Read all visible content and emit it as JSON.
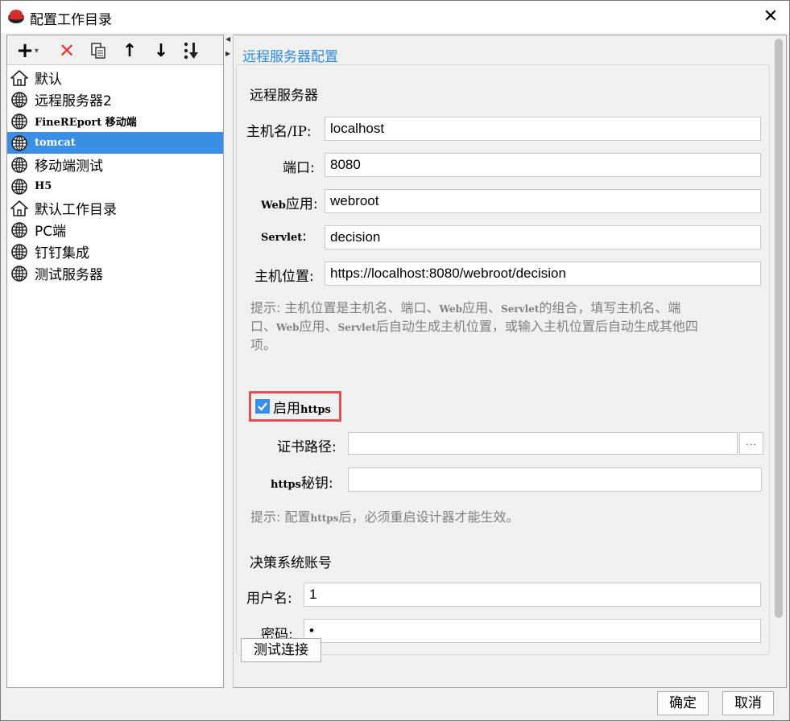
{
  "window": {
    "title": "配置工作目录",
    "close_glyph": "✕"
  },
  "toolbar": {
    "add": "+",
    "add_dropdown": "▾",
    "delete": "✕",
    "copy": "copy-icon",
    "move_up": "↑",
    "move_down": "↓",
    "sort": "sort-icon"
  },
  "tree": {
    "items": [
      {
        "label": "默认",
        "icon": "home-icon",
        "mono": false,
        "selected": false
      },
      {
        "label": "远程服务器2",
        "icon": "globe-icon",
        "mono": false,
        "selected": false
      },
      {
        "label": "FineREport 移动端",
        "icon": "globe-icon",
        "mono": true,
        "selected": false
      },
      {
        "label": "tomcat",
        "icon": "globe-icon",
        "mono": true,
        "selected": true
      },
      {
        "label": "移动端测试",
        "icon": "globe-icon",
        "mono": false,
        "selected": false
      },
      {
        "label": "H5",
        "icon": "globe-icon",
        "mono": true,
        "selected": false
      },
      {
        "label": "默认工作目录",
        "icon": "home-icon",
        "mono": false,
        "selected": false
      },
      {
        "label": "PC端",
        "icon": "globe-icon",
        "mono": false,
        "selected": false
      },
      {
        "label": "钉钉集成",
        "icon": "globe-icon",
        "mono": false,
        "selected": false
      },
      {
        "label": "测试服务器",
        "icon": "globe-icon",
        "mono": false,
        "selected": false
      }
    ]
  },
  "form": {
    "panel_title": "远程服务器配置",
    "remote_section": "远程服务器",
    "host_label": "主机名/IP",
    "host_label_suffix": ":",
    "host_value": "localhost",
    "port_label": "端口:",
    "port_value": "8080",
    "webapp_label_prefix": "Web",
    "webapp_label_suffix": "应用:",
    "webapp_value": "webroot",
    "servlet_label": "Servlet",
    "servlet_label_suffix": ":",
    "servlet_value": "decision",
    "location_label": "主机位置:",
    "location_value": "https://localhost:8080/webroot/decision",
    "hint1_line1_a": "提示: 主机位置是主机名、端口、",
    "hint1_line1_web": "Web",
    "hint1_line1_b": "应用、",
    "hint1_line1_servlet": "Servlet",
    "hint1_line1_c": "的组合，填写主机名、端",
    "hint1_line2_a": "口、",
    "hint1_line2_web": "Web",
    "hint1_line2_b": "应用、",
    "hint1_line2_servlet": "Servlet",
    "hint1_line2_c": "后自动生成主机位置，或输入主机位置后自动生成其他四",
    "hint1_line3": "项。",
    "https_checkbox_prefix": "启用",
    "https_checkbox_suffix": "https",
    "https_checked": true,
    "cert_label": "证书路径:",
    "cert_value": "",
    "browse_label": "...",
    "https_key_prefix": "https",
    "https_key_suffix": "秘钥:",
    "https_key_value": "",
    "hint2_a": "提示: 配置",
    "hint2_https": "https",
    "hint2_b": "后，必须重启设计器才能生效。",
    "account_section": "决策系统账号",
    "username_label": "用户名:",
    "username_value": "1",
    "password_label": "密码:",
    "password_value": "•",
    "test_button": "测试连接"
  },
  "footer": {
    "ok": "确定",
    "cancel": "取消"
  },
  "colors": {
    "accent": "#3b8ee6",
    "title_blue": "#2c8ad8",
    "highlight_red": "#e05252",
    "delete_red": "#e53935"
  }
}
